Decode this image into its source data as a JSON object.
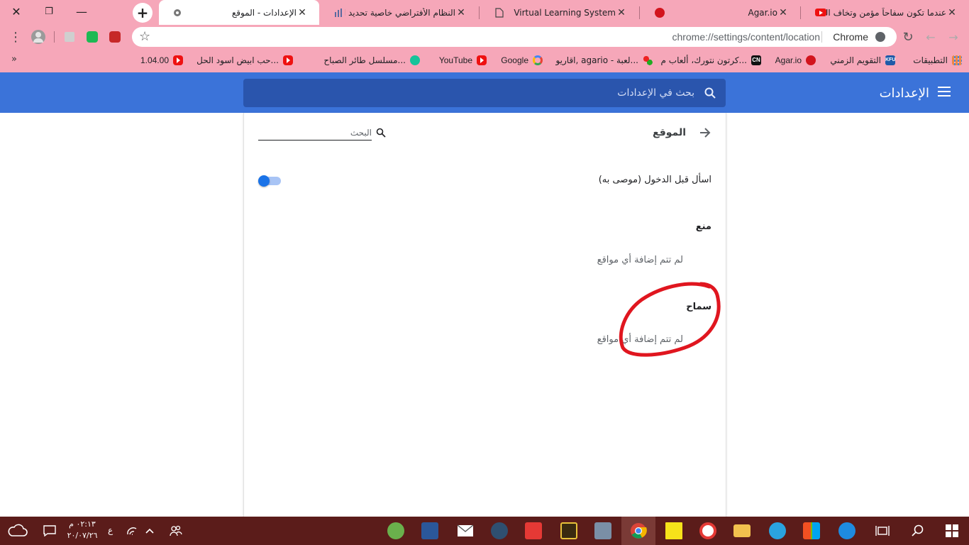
{
  "window": {
    "close_glyph": "✕",
    "restore_glyph": "❐",
    "minimize_glyph": "—"
  },
  "tabs": [
    {
      "title": "عندما تكون سفاحاً مؤمن وتخاف الله",
      "icon": "youtube-icon",
      "close": "✕"
    },
    {
      "title": "Agar.io",
      "icon": "agar-icon",
      "close": "✕"
    },
    {
      "title": "Virtual Learning System",
      "icon": "page-icon",
      "close": "✕"
    },
    {
      "title": "النظام الأفتراضي خاصية تحديد الموقع",
      "icon": "chart-icon",
      "close": "✕"
    },
    {
      "title": "الإعدادات - الموقع",
      "icon": "settings-gear-icon",
      "close": "✕",
      "active": true
    }
  ],
  "new_tab_glyph": "+",
  "toolbar": {
    "url": "chrome://settings/content/location",
    "site_label": "Chrome",
    "back_glyph": "←",
    "forward_glyph": "→",
    "reload_glyph": "↻",
    "star_glyph": "☆",
    "menu_glyph": "⋮"
  },
  "bookmarks": [
    {
      "label": "التطبيقات",
      "icon": "apps-grid-icon"
    },
    {
      "label": "التقويم الزمني",
      "icon": "kfu-icon"
    },
    {
      "label": "Agar.io",
      "icon": "agar-icon"
    },
    {
      "label": "كرتون نتورك، ألعاب م...",
      "icon": "cartoon-network-icon"
    },
    {
      "label": "اقاريو, agario - لعبة...",
      "icon": "agario-icon"
    },
    {
      "label": "Google",
      "icon": "google-icon"
    },
    {
      "label": "YouTube",
      "icon": "youtube-icon"
    },
    {
      "label": "مسلسل طائر الصباح...",
      "icon": "grammarly-icon"
    },
    {
      "label": "حب ابيض اسود الحل...",
      "icon": "youtube-icon"
    },
    {
      "label": "1.04.00",
      "icon": "youtube-icon"
    }
  ],
  "bookmarks_overflow": "»",
  "settings": {
    "header_title": "الإعدادات",
    "search_placeholder": "بحث في الإعدادات",
    "page_title": "الموقع",
    "local_search_placeholder": "البحث",
    "ask_label": "اسأل قبل الدخول (موصى به)",
    "ask_enabled": true,
    "block_heading": "منع",
    "block_empty": "لم تتم إضافة أي مواقع",
    "allow_heading": "سماح",
    "allow_empty": "لم تتم إضافة أي مواقع"
  },
  "taskbar": {
    "time": "٠٢:١٣ م",
    "date": "٢٠/٠٧/٢٦",
    "language": "ع"
  },
  "colors": {
    "chrome_frame": "#f6a7b9",
    "settings_blue": "#3b73d9",
    "search_blue": "#2a55ad",
    "toggle_blue": "#1a73e8",
    "annotation_red": "#e0161f",
    "taskbar": "#5b1c1a"
  }
}
